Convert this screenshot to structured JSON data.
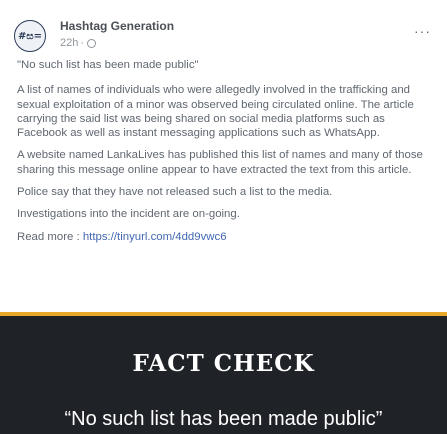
{
  "post": {
    "avatar_text": "#ස=",
    "author": "Hashtag Generation",
    "time": "22h",
    "time_separator": "·",
    "more_icon": "more-horizontal-icon",
    "paragraphs": [
      "\"No such list has been made public\"",
      "A list of names of individuals who were allegedly involved in the trafficking and sexual exploitation of a minor was observed being circulated online. The article carrying the said list was being shared on social media platforms such as Facebook as well as instant messaging applications such as WhatsApp.",
      "A website named LankaLives has published this list of names and many of those sharing this message online appear to have extracted the text from this article.",
      "Police say that they have not released such a list to the media.",
      "Investigations into the incident are on-going."
    ],
    "read_more_label": "Read more : ",
    "read_more_link": "https://tinyurl.com/4dd9vwc6"
  },
  "banner": {
    "accent_color": "#e8a829",
    "background_color": "#1f2328",
    "title": "FACT CHECK",
    "quote": "“No such list has been made public”"
  }
}
